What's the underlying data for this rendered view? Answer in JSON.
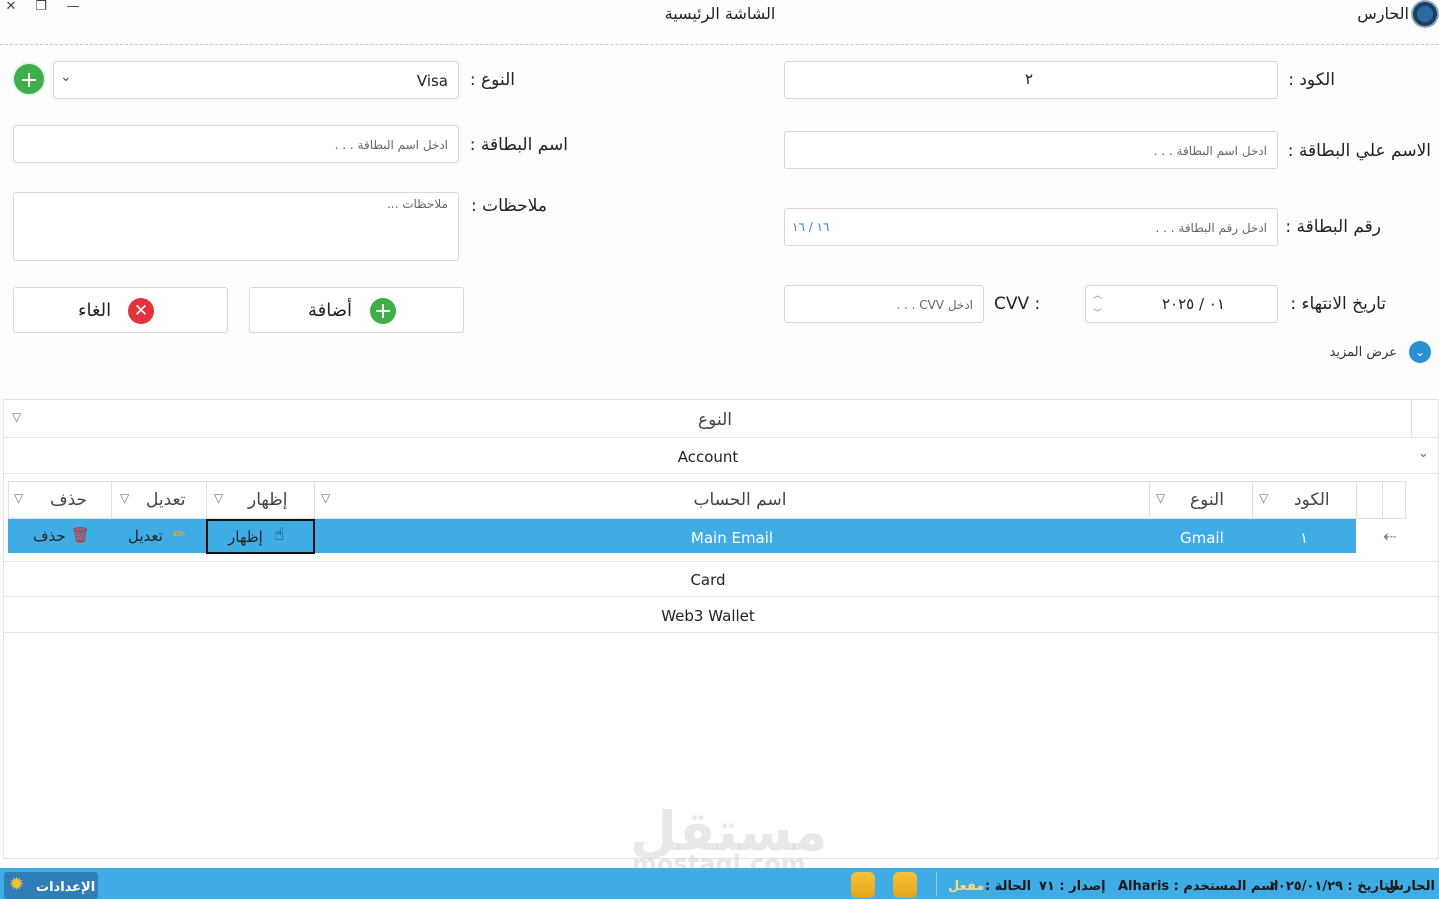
{
  "window": {
    "app_title": "الحارس",
    "title": "الشاشة الرئيسية",
    "close_glyph": "✕",
    "restore_glyph": "❐",
    "minimize_glyph": "—"
  },
  "form": {
    "code_label": "الكود :",
    "code_value": "٢",
    "type_label": "النوع :",
    "type_value": "Visa",
    "name_on_card_label": "الاسم علي البطاقة :",
    "name_on_card_placeholder": "ادخل اسم البطاقة . . .",
    "card_name_label": "اسم البطاقة :",
    "card_name_placeholder": "ادخل اسم البطاقة . . .",
    "card_number_label": "رقم البطاقة :",
    "card_number_placeholder": "ادخل رقم البطاقة . . .",
    "card_number_counter": "١٦ / ١٦",
    "notes_label": "ملاحظات :",
    "notes_placeholder": "ملاحظات ...",
    "expiry_label": "تاريخ الانتهاء :",
    "expiry_value": "٠١ / ٢٠٢٥",
    "cvv_label": "CVV :",
    "cvv_placeholder": "ادخل CVV . . .",
    "add_button": "أضافة",
    "cancel_button": "الغاء",
    "show_more": "عرض المزيد"
  },
  "grid": {
    "group_header": "النوع",
    "groups": [
      "Account",
      "Card",
      "Web3 Wallet"
    ],
    "columns": {
      "code": "الكود",
      "type": "النوع",
      "account_name": "اسم الحساب",
      "show": "إظهار",
      "edit": "تعديل",
      "delete": "حذف"
    },
    "rows": [
      {
        "code": "١",
        "type": "Gmail",
        "account_name": "Main Email",
        "show": "إظهار",
        "edit": "تعديل",
        "delete": "حذف"
      }
    ]
  },
  "statusbar": {
    "app": "الحارس",
    "date": "التاريخ : ٢٠٢٥/٠١/٢٩",
    "username": "اسم المستخدم : Alharis",
    "version": "إصدار : ٧١",
    "status_label": "الحالة :",
    "status_value": "مفعل",
    "settings": "الإعدادات"
  },
  "watermark": {
    "arabic": "مستقل",
    "latin": "mostaql.com"
  },
  "colors": {
    "accent": "#40ace6",
    "green": "#3fae49",
    "red": "#e0333a",
    "selected_row": "#40ace6"
  }
}
